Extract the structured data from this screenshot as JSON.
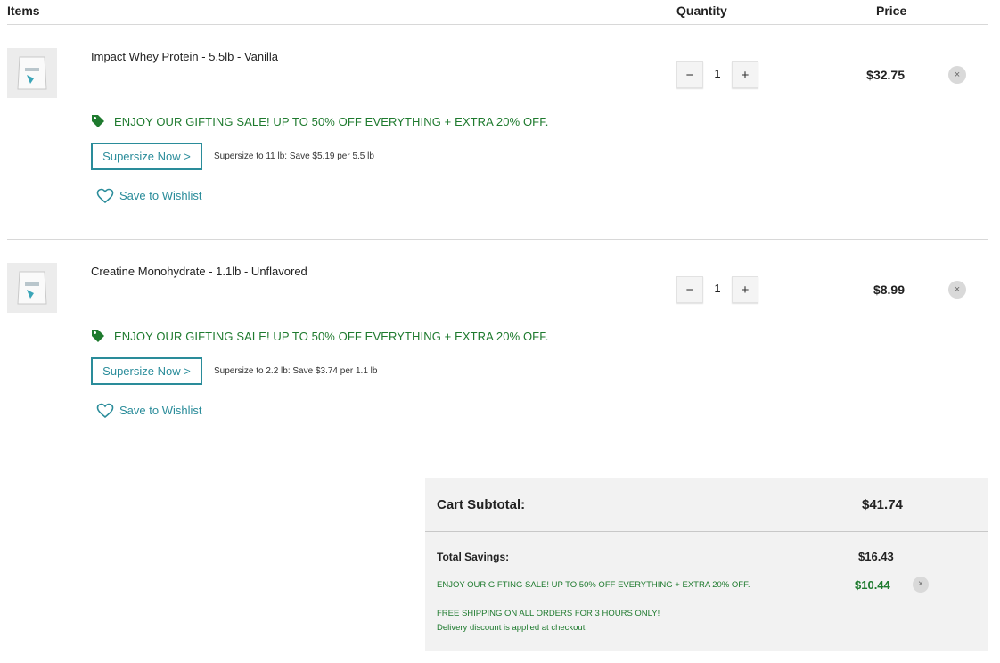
{
  "header": {
    "items_label": "Items",
    "quantity_label": "Quantity",
    "price_label": "Price"
  },
  "cart_items": [
    {
      "name": "Impact Whey Protein - 5.5lb - Vanilla",
      "quantity": "1",
      "price": "$32.75",
      "promo": "ENJOY OUR GIFTING SALE! UP TO 50% OFF EVERYTHING + EXTRA 20% OFF.",
      "supersize_label": "Supersize Now >",
      "supersize_note": "Supersize to 11 lb: Save $5.19 per 5.5 lb",
      "wishlist_label": "Save to Wishlist",
      "decrement": "−",
      "increment": "+",
      "remove": "×"
    },
    {
      "name": "Creatine Monohydrate - 1.1lb - Unflavored",
      "quantity": "1",
      "price": "$8.99",
      "promo": "ENJOY OUR GIFTING SALE! UP TO 50% OFF EVERYTHING + EXTRA 20% OFF.",
      "supersize_label": "Supersize Now >",
      "supersize_note": "Supersize to 2.2 lb: Save $3.74 per 1.1 lb",
      "wishlist_label": "Save to Wishlist",
      "decrement": "−",
      "increment": "+",
      "remove": "×"
    }
  ],
  "summary": {
    "subtotal_label": "Cart Subtotal:",
    "subtotal_value": "$41.74",
    "savings_label": "Total Savings:",
    "savings_value": "$16.43",
    "discount_label": "ENJOY OUR GIFTING SALE! UP TO 50% OFF EVERYTHING + EXTRA 20% OFF.",
    "discount_value": "$10.44",
    "discount_remove": "×",
    "shipping_label": "FREE SHIPPING ON ALL ORDERS FOR 3 HOURS ONLY!",
    "shipping_note": "Delivery discount is applied at checkout"
  },
  "colors": {
    "promo_green": "#1e7a2e",
    "accent_teal": "#2a8c9a"
  },
  "icons": [
    "tag-icon",
    "heart-icon",
    "close-icon",
    "product-image"
  ]
}
